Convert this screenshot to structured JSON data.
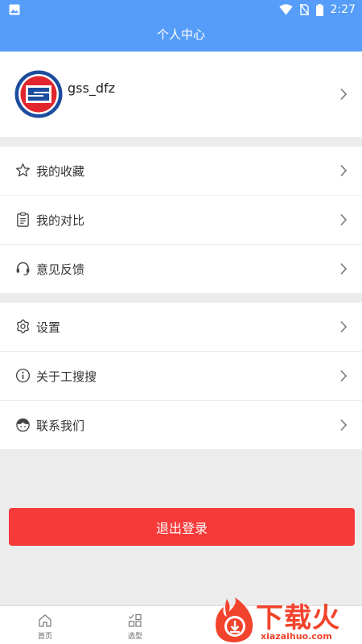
{
  "status_bar": {
    "time": "2:27"
  },
  "header": {
    "title": "个人中心"
  },
  "profile": {
    "username": "gss_dfz"
  },
  "menu_group_1": [
    {
      "label": "我的收藏",
      "icon": "star-icon"
    },
    {
      "label": "我的对比",
      "icon": "clipboard-icon"
    },
    {
      "label": "意见反馈",
      "icon": "headset-icon"
    }
  ],
  "menu_group_2": [
    {
      "label": "设置",
      "icon": "gear-icon"
    },
    {
      "label": "关于工搜搜",
      "icon": "info-icon"
    },
    {
      "label": "联系我们",
      "icon": "contact-person-icon"
    }
  ],
  "logout": {
    "label": "退出登录"
  },
  "tabs": [
    {
      "label": "首页",
      "icon": "home-icon"
    },
    {
      "label": "选型",
      "icon": "selection-icon"
    }
  ],
  "watermark": {
    "text": "下载火",
    "url": "xiazaihuo.com"
  },
  "colors": {
    "header": "#559df8",
    "logout": "#f63a3a",
    "background": "#ececec"
  }
}
